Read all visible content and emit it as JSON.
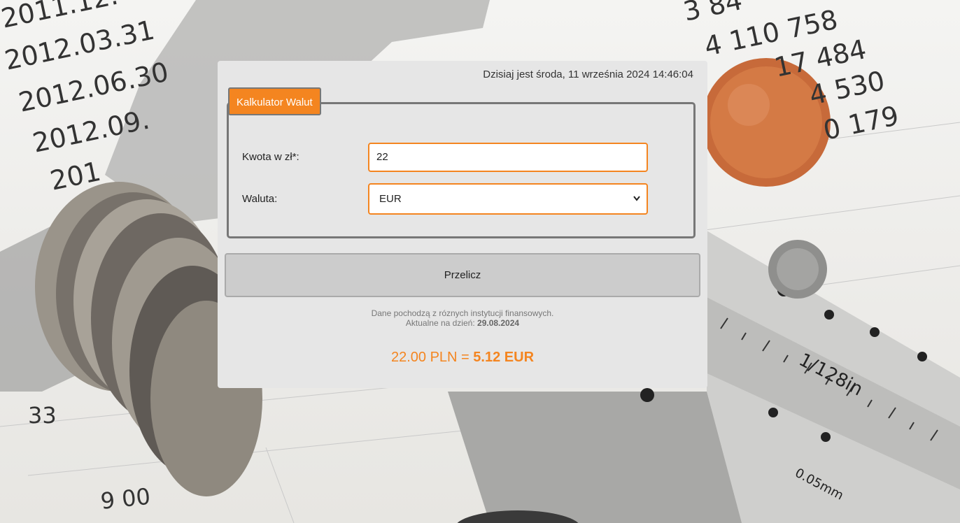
{
  "header": {
    "date_text": "Dzisiaj jest środa, 11 września 2024 14:46:04"
  },
  "calculator": {
    "legend": "Kalkulator Walut",
    "amount_label": "Kwota w zł*:",
    "amount_value": "22",
    "currency_label": "Waluta:",
    "currency_selected": "EUR",
    "convert_button": "Przelicz"
  },
  "note": {
    "source_text": "Dane pochodzą z róznych instytucji finansowych.",
    "updated_prefix": "Aktualne na dzień:",
    "updated_date": "29.08.2024"
  },
  "result": {
    "from_text": "22.00 PLN =",
    "to_text": "5.12 EUR"
  },
  "background": {
    "left_numbers": [
      "2011.12.",
      "2012.03.31",
      "2012.06.30",
      "2012.09.",
      "201"
    ],
    "right_numbers": [
      "3 84",
      "4 110 758",
      "17 484",
      "4 530",
      "0 179"
    ],
    "bottom_numbers": [
      "9 00",
      "33"
    ],
    "caliper_text": [
      "1/128in",
      "0.05mm"
    ]
  },
  "colors": {
    "accent": "#f48520",
    "panel": "#e6e6e6"
  }
}
